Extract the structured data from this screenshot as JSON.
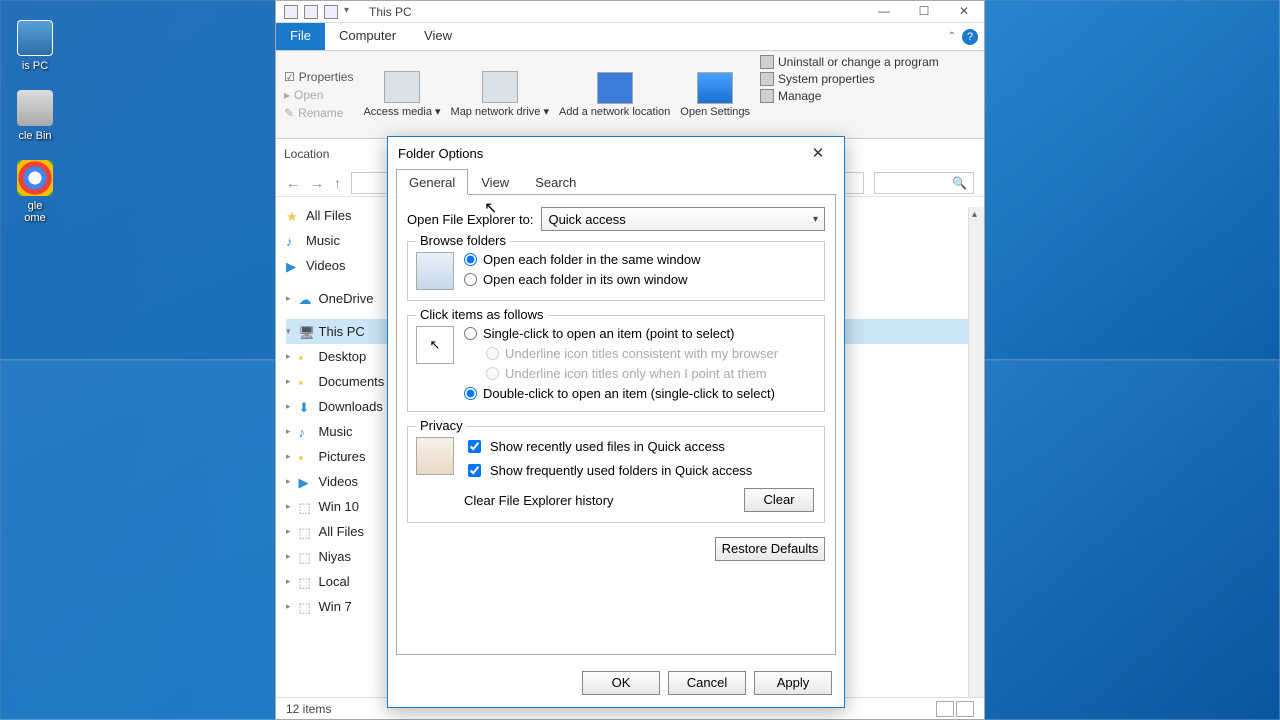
{
  "desktop_icons": {
    "pc": "is PC",
    "bin": "cle Bin",
    "chrome1": "gle",
    "chrome2": "ome"
  },
  "explorer": {
    "title": "This PC",
    "tabs": {
      "file": "File",
      "computer": "Computer",
      "view": "View"
    },
    "ribbon": {
      "properties": "Properties",
      "open": "Open",
      "rename": "Rename",
      "access_media": "Access media ▾",
      "map_drive": "Map network drive ▾",
      "add_location": "Add a network location",
      "open_settings": "Open Settings",
      "uninstall": "Uninstall or change a program",
      "sys_props": "System properties",
      "manage": "Manage",
      "location": "Location"
    },
    "tree": {
      "all_files": "All Files",
      "music": "Music",
      "videos": "Videos",
      "onedrive": "OneDrive",
      "this_pc": "This PC",
      "desktop": "Desktop",
      "documents": "Documents",
      "downloads": "Downloads",
      "music2": "Music",
      "pictures": "Pictures",
      "videos2": "Videos",
      "win10": "Win 10",
      "all_files2": "All Files",
      "niyas": "Niyas",
      "local": "Local",
      "win7": "Win 7"
    },
    "status": "12 items"
  },
  "dialog": {
    "title": "Folder Options",
    "tabs": {
      "general": "General",
      "view": "View",
      "search": "Search"
    },
    "open_to_label": "Open File Explorer to:",
    "open_to_value": "Quick access",
    "browse": {
      "legend": "Browse folders",
      "same": "Open each folder in the same window",
      "own": "Open each folder in its own window"
    },
    "click": {
      "legend": "Click items as follows",
      "single": "Single-click to open an item (point to select)",
      "underline1": "Underline icon titles consistent with my browser",
      "underline2": "Underline icon titles only when I point at them",
      "double": "Double-click to open an item (single-click to select)"
    },
    "privacy": {
      "legend": "Privacy",
      "recent": "Show recently used files in Quick access",
      "frequent": "Show frequently used folders in Quick access",
      "clear_label": "Clear File Explorer history",
      "clear_btn": "Clear"
    },
    "restore": "Restore Defaults",
    "ok": "OK",
    "cancel": "Cancel",
    "apply": "Apply"
  }
}
